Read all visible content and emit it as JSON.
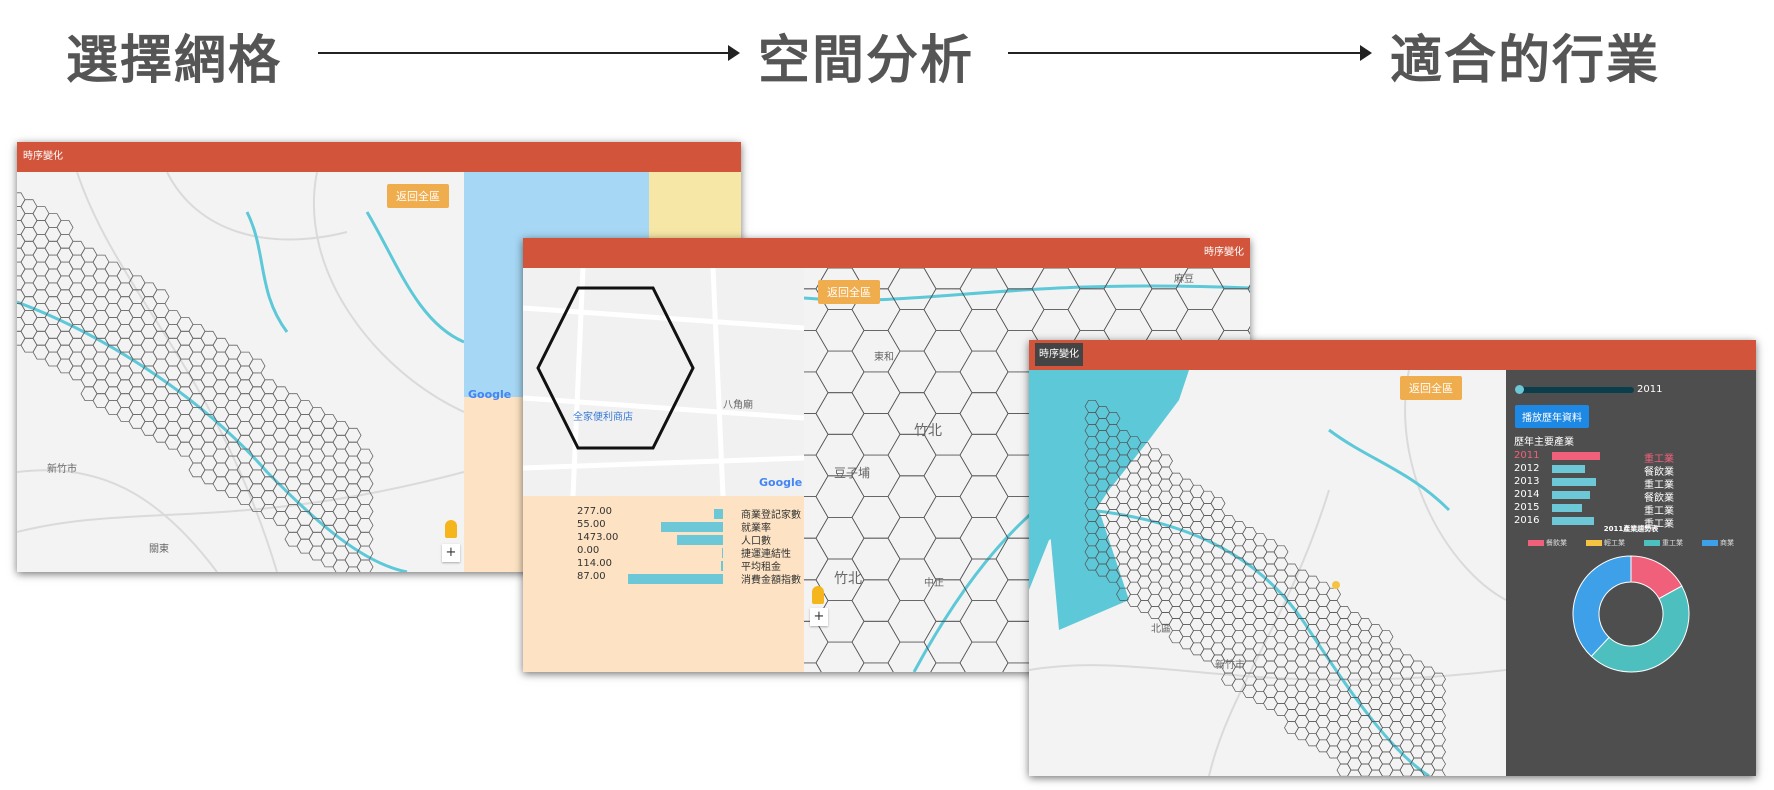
{
  "steps": [
    "選擇網格",
    "空間分析",
    "適合的行業"
  ],
  "window1": {
    "title": "時序變化",
    "return_button": "返回全區",
    "map_labels": [
      "新竹市",
      "關東"
    ],
    "google_logo": "Google"
  },
  "window2": {
    "title": "時序變化",
    "return_button": "返回全區",
    "map_labels": [
      "全家便利商店",
      "八角廟",
      "竹北",
      "豆子埔",
      "竹北",
      "中正",
      "東和",
      "麻豆"
    ],
    "google_logo": "Google",
    "stats": [
      {
        "label": "商業登記家數",
        "value": "277.00",
        "bar": 0.1
      },
      {
        "label": "就業率",
        "value": "55.00",
        "bar": 0.65
      },
      {
        "label": "人口數",
        "value": "1473.00",
        "bar": 0.48
      },
      {
        "label": "捷運連結性",
        "value": "0.00",
        "bar": 0.0
      },
      {
        "label": "平均租金",
        "value": "114.00",
        "bar": 0.02
      },
      {
        "label": "消費金額指數",
        "value": "87.00",
        "bar": 1.0
      }
    ]
  },
  "window3": {
    "title": "時序變化",
    "return_button": "返回全區",
    "map_labels": [
      "新竹市",
      "北區"
    ],
    "slider_year": "2011",
    "play_button": "播放歷年資料",
    "section_title": "歷年主要產業",
    "years": [
      {
        "year": "2011",
        "industry": "重工業",
        "bar": 1.0,
        "highlight": true
      },
      {
        "year": "2012",
        "industry": "餐飲業",
        "bar": 0.68,
        "highlight": false
      },
      {
        "year": "2013",
        "industry": "重工業",
        "bar": 0.92,
        "highlight": false
      },
      {
        "year": "2014",
        "industry": "餐飲業",
        "bar": 0.8,
        "highlight": false
      },
      {
        "year": "2015",
        "industry": "重工業",
        "bar": 0.62,
        "highlight": false
      },
      {
        "year": "2016",
        "industry": "重工業",
        "bar": 0.88,
        "highlight": false
      }
    ],
    "donut_title": "2011產業趨勢表",
    "legend": [
      {
        "label": "餐飲業",
        "color": "#f0607a"
      },
      {
        "label": "輕工業",
        "color": "#f5c344"
      },
      {
        "label": "重工業",
        "color": "#4ebfbf"
      },
      {
        "label": "商業",
        "color": "#3ea0e8"
      }
    ]
  },
  "colors": {
    "title_bar": "#d2553b",
    "accent_orange": "#f0ad4e",
    "water": "#5cc8d8",
    "bar": "#6cc7d6",
    "highlight_red": "#f0607a"
  },
  "chart_data": {
    "type": "pie",
    "title": "2011產業趨勢表",
    "categories": [
      "餐飲業",
      "輕工業",
      "重工業",
      "商業"
    ],
    "values": [
      17,
      0,
      45,
      38
    ]
  }
}
